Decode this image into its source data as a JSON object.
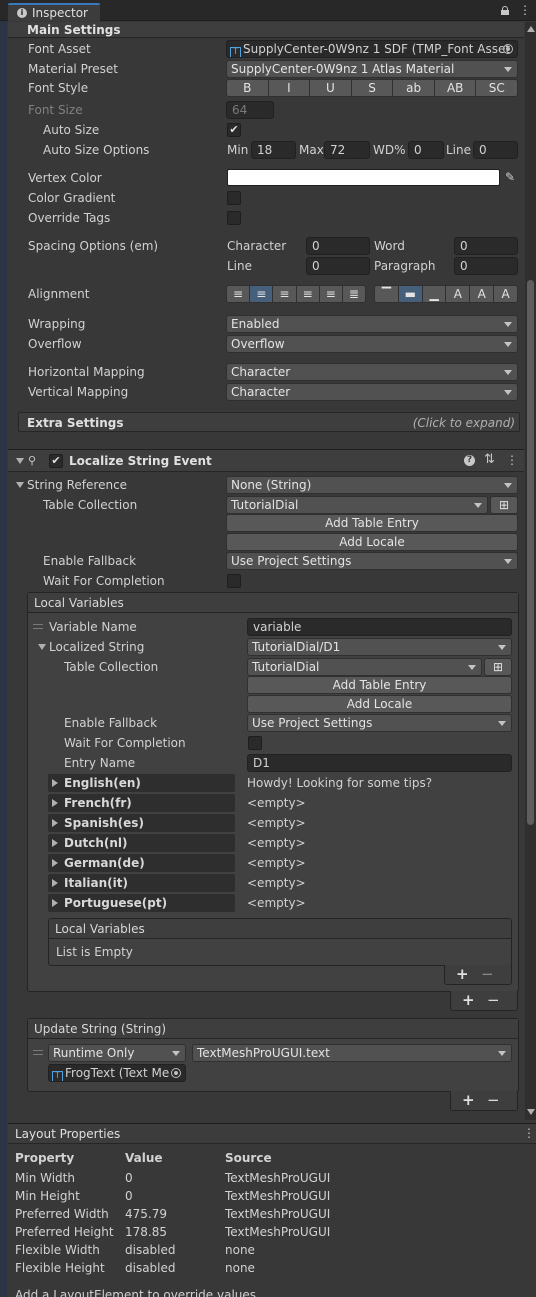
{
  "window": {
    "title": "Inspector"
  },
  "main_settings": {
    "header": "Main Settings",
    "font_asset": {
      "label": "Font Asset",
      "value": "SupplyCenter-0W9nz 1 SDF (TMP_Font Asset"
    },
    "material_preset": {
      "label": "Material Preset",
      "value": "SupplyCenter-0W9nz 1 Atlas Material"
    },
    "font_style": {
      "label": "Font Style",
      "buttons": [
        "B",
        "I",
        "U",
        "S",
        "ab",
        "AB",
        "SC"
      ]
    },
    "font_size": {
      "label": "Font Size",
      "value": "64"
    },
    "auto_size": {
      "label": "Auto Size",
      "checked": "✔"
    },
    "auto_size_options": {
      "label": "Auto Size Options",
      "min_label": "Min",
      "min": "18",
      "max_label": "Max",
      "max": "72",
      "wd_label": "WD%",
      "wd": "0",
      "line_label": "Line",
      "line": "0"
    },
    "vertex_color": {
      "label": "Vertex Color",
      "color": "#ffffff"
    },
    "color_gradient": {
      "label": "Color Gradient"
    },
    "override_tags": {
      "label": "Override Tags"
    },
    "spacing": {
      "label": "Spacing Options (em)",
      "character_label": "Character",
      "character": "0",
      "word_label": "Word",
      "word": "0",
      "line_label": "Line",
      "line": "0",
      "paragraph_label": "Paragraph",
      "paragraph": "0"
    },
    "alignment": {
      "label": "Alignment"
    },
    "wrapping": {
      "label": "Wrapping",
      "value": "Enabled"
    },
    "overflow": {
      "label": "Overflow",
      "value": "Overflow"
    },
    "horizontal_mapping": {
      "label": "Horizontal Mapping",
      "value": "Character"
    },
    "vertical_mapping": {
      "label": "Vertical Mapping",
      "value": "Character"
    },
    "extra_settings": {
      "label": "Extra Settings",
      "hint": "(Click to expand)"
    }
  },
  "localize": {
    "title": "Localize String Event",
    "checked": "✔",
    "string_reference": {
      "label": "String Reference",
      "value": "None (String)"
    },
    "table_collection": {
      "label": "Table Collection",
      "value": "TutorialDial"
    },
    "add_table_entry": "Add Table Entry",
    "add_locale": "Add Locale",
    "enable_fallback": {
      "label": "Enable Fallback",
      "value": "Use Project Settings"
    },
    "wait_for_completion": {
      "label": "Wait For Completion"
    },
    "local_variables": {
      "header": "Local Variables",
      "variable_name": {
        "label": "Variable Name",
        "value": "variable"
      },
      "localized_string": {
        "label": "Localized String",
        "value": "TutorialDial/D1"
      },
      "table_collection": {
        "label": "Table Collection",
        "value": "TutorialDial"
      },
      "add_table_entry": "Add Table Entry",
      "add_locale": "Add Locale",
      "enable_fallback": {
        "label": "Enable Fallback",
        "value": "Use Project Settings"
      },
      "wait_for_completion": {
        "label": "Wait For Completion"
      },
      "entry_name": {
        "label": "Entry Name",
        "value": "D1"
      },
      "locales": [
        {
          "name": "English(en)",
          "value": "Howdy! Looking for some tips?"
        },
        {
          "name": "French(fr)",
          "value": "<empty>"
        },
        {
          "name": "Spanish(es)",
          "value": "<empty>"
        },
        {
          "name": "Dutch(nl)",
          "value": "<empty>"
        },
        {
          "name": "German(de)",
          "value": "<empty>"
        },
        {
          "name": "Italian(it)",
          "value": "<empty>"
        },
        {
          "name": "Portuguese(pt)",
          "value": "<empty>"
        }
      ],
      "nested": {
        "header": "Local Variables",
        "empty": "List is Empty"
      },
      "plus": "+",
      "minus": "−"
    },
    "update_string": {
      "header": "Update String (String)",
      "mode": "Runtime Only",
      "function": "TextMeshProUGUI.text",
      "target": "FrogText (Text Me"
    }
  },
  "layout_properties": {
    "title": "Layout Properties",
    "columns": [
      "Property",
      "Value",
      "Source"
    ],
    "rows": [
      [
        "Min Width",
        "0",
        "TextMeshProUGUI"
      ],
      [
        "Min Height",
        "0",
        "TextMeshProUGUI"
      ],
      [
        "Preferred Width",
        "475.79",
        "TextMeshProUGUI"
      ],
      [
        "Preferred Height",
        "178.85",
        "TextMeshProUGUI"
      ],
      [
        "Flexible Width",
        "disabled",
        "none"
      ],
      [
        "Flexible Height",
        "disabled",
        "none"
      ]
    ],
    "footer": "Add a LayoutElement to override values."
  }
}
